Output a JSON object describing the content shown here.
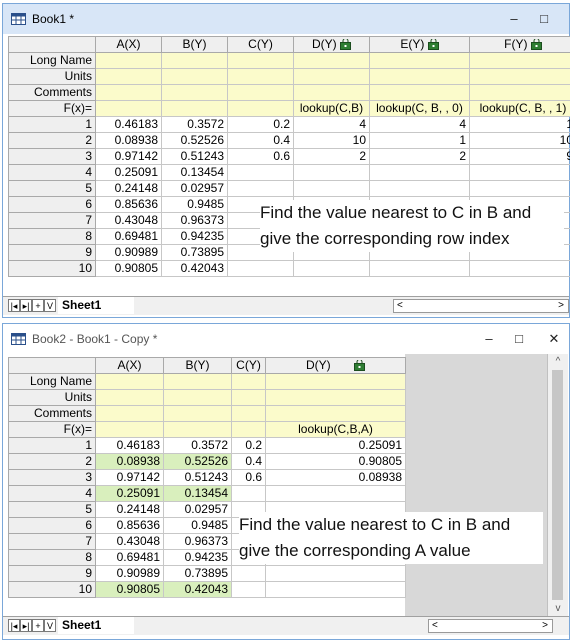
{
  "book1": {
    "title": "Book1 *",
    "controls": {
      "minimize": "–",
      "maximize": "□"
    },
    "columns": [
      "A(X)",
      "B(Y)",
      "C(Y)",
      "D(Y)",
      "E(Y)",
      "F(Y)"
    ],
    "meta_rows": [
      "Long Name",
      "Units",
      "Comments",
      "F(x)="
    ],
    "formulas": [
      "",
      "",
      "",
      "lookup(C,B)",
      "lookup(C, B, , 0)",
      "lookup(C, B, , 1)"
    ],
    "rows": [
      {
        "n": "1",
        "a": "0.46183",
        "b": "0.3572",
        "c": "0.2",
        "d": "4",
        "e": "4",
        "f": "1"
      },
      {
        "n": "2",
        "a": "0.08938",
        "b": "0.52526",
        "c": "0.4",
        "d": "10",
        "e": "1",
        "f": "10"
      },
      {
        "n": "3",
        "a": "0.97142",
        "b": "0.51243",
        "c": "0.6",
        "d": "2",
        "e": "2",
        "f": "9"
      },
      {
        "n": "4",
        "a": "0.25091",
        "b": "0.13454",
        "c": "",
        "d": "",
        "e": "",
        "f": ""
      },
      {
        "n": "5",
        "a": "0.24148",
        "b": "0.02957",
        "c": "",
        "d": "",
        "e": "",
        "f": ""
      },
      {
        "n": "6",
        "a": "0.85636",
        "b": "0.9485",
        "c": "",
        "d": "",
        "e": "",
        "f": ""
      },
      {
        "n": "7",
        "a": "0.43048",
        "b": "0.96373",
        "c": "",
        "d": "",
        "e": "",
        "f": ""
      },
      {
        "n": "8",
        "a": "0.69481",
        "b": "0.94235",
        "c": "",
        "d": "",
        "e": "",
        "f": ""
      },
      {
        "n": "9",
        "a": "0.90989",
        "b": "0.73895",
        "c": "",
        "d": "",
        "e": "",
        "f": ""
      },
      {
        "n": "10",
        "a": "0.90805",
        "b": "0.42043",
        "c": "",
        "d": "",
        "e": "",
        "f": ""
      }
    ],
    "sheet_tab": "Sheet1",
    "note_lines": [
      "Find the value nearest to C in B and",
      "give the corresponding row index"
    ]
  },
  "book2": {
    "title": "Book2 - Book1 - Copy *",
    "controls": {
      "minimize": "–",
      "maximize": "□",
      "close": "✕"
    },
    "columns": [
      "A(X)",
      "B(Y)",
      "C(Y)",
      "D(Y)"
    ],
    "meta_rows": [
      "Long Name",
      "Units",
      "Comments",
      "F(x)="
    ],
    "formulas": [
      "",
      "",
      "",
      "lookup(C,B,A)"
    ],
    "rows": [
      {
        "n": "1",
        "a": "0.46183",
        "b": "0.3572",
        "c": "0.2",
        "d": "0.25091",
        "hl": false
      },
      {
        "n": "2",
        "a": "0.08938",
        "b": "0.52526",
        "c": "0.4",
        "d": "0.90805",
        "hl": true
      },
      {
        "n": "3",
        "a": "0.97142",
        "b": "0.51243",
        "c": "0.6",
        "d": "0.08938",
        "hl": false
      },
      {
        "n": "4",
        "a": "0.25091",
        "b": "0.13454",
        "c": "",
        "d": "",
        "hl": true
      },
      {
        "n": "5",
        "a": "0.24148",
        "b": "0.02957",
        "c": "",
        "d": "",
        "hl": false
      },
      {
        "n": "6",
        "a": "0.85636",
        "b": "0.9485",
        "c": "",
        "d": "",
        "hl": false
      },
      {
        "n": "7",
        "a": "0.43048",
        "b": "0.96373",
        "c": "",
        "d": "",
        "hl": false
      },
      {
        "n": "8",
        "a": "0.69481",
        "b": "0.94235",
        "c": "",
        "d": "",
        "hl": false
      },
      {
        "n": "9",
        "a": "0.90989",
        "b": "0.73895",
        "c": "",
        "d": "",
        "hl": false
      },
      {
        "n": "10",
        "a": "0.90805",
        "b": "0.42043",
        "c": "",
        "d": "",
        "hl": true
      }
    ],
    "sheet_tab": "Sheet1",
    "note_lines": [
      "Find the value nearest to C in B and",
      "give the corresponding A value"
    ]
  },
  "colors": {
    "book1_titlebar": "#d8e6f7",
    "book2_titlebar": "#ffffff",
    "meta_fill": "#fbfbcb",
    "highlight": "#d9efbd",
    "header_fill": "#efefef",
    "desktop": "#d8d8d8",
    "window_border": "#7aa7d9"
  },
  "icons": [
    "worksheet-book-icon",
    "lock-column-icon",
    "scroll-left-icon",
    "scroll-right-icon",
    "scroll-up-icon",
    "scroll-down-icon"
  ],
  "nav_buttons": [
    "|◂",
    "▸|",
    "+",
    "V"
  ]
}
